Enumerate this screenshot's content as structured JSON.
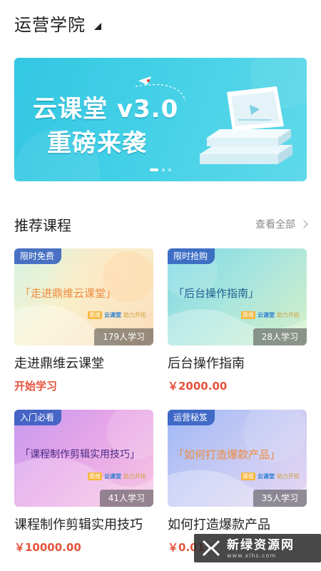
{
  "header": {
    "title": "运营学院"
  },
  "banner": {
    "line1": "云课堂 v3.0",
    "line2": "重磅来袭",
    "indicator": {
      "count": 3,
      "active": 0
    }
  },
  "section": {
    "title": "推荐课程",
    "more": "查看全部"
  },
  "brand": {
    "b1": "鼎维",
    "b2": "云课堂",
    "b3": "助力开拓"
  },
  "courses": [
    {
      "tag": "限时免费",
      "thumb_title": "「走进鼎维云课堂」",
      "count": "179人学习",
      "name": "走进鼎维云课堂",
      "price": "开始学习"
    },
    {
      "tag": "限时抢购",
      "thumb_title": "「后台操作指南」",
      "count": "28人学习",
      "name": "后台操作指南",
      "price": "￥2000.00"
    },
    {
      "tag": "入门必看",
      "thumb_title": "「课程制作剪辑实用技巧」",
      "count": "41人学习",
      "name": "课程制作剪辑实用技巧",
      "price": "￥10000.00"
    },
    {
      "tag": "运营秘笈",
      "thumb_title": "「如何打造爆款产品」",
      "count": "35人学习",
      "name": "如何打造爆款产品",
      "price": "￥0.01"
    }
  ],
  "watermark": {
    "cn": "新绿资源网",
    "url": "www.xlhs.com"
  }
}
